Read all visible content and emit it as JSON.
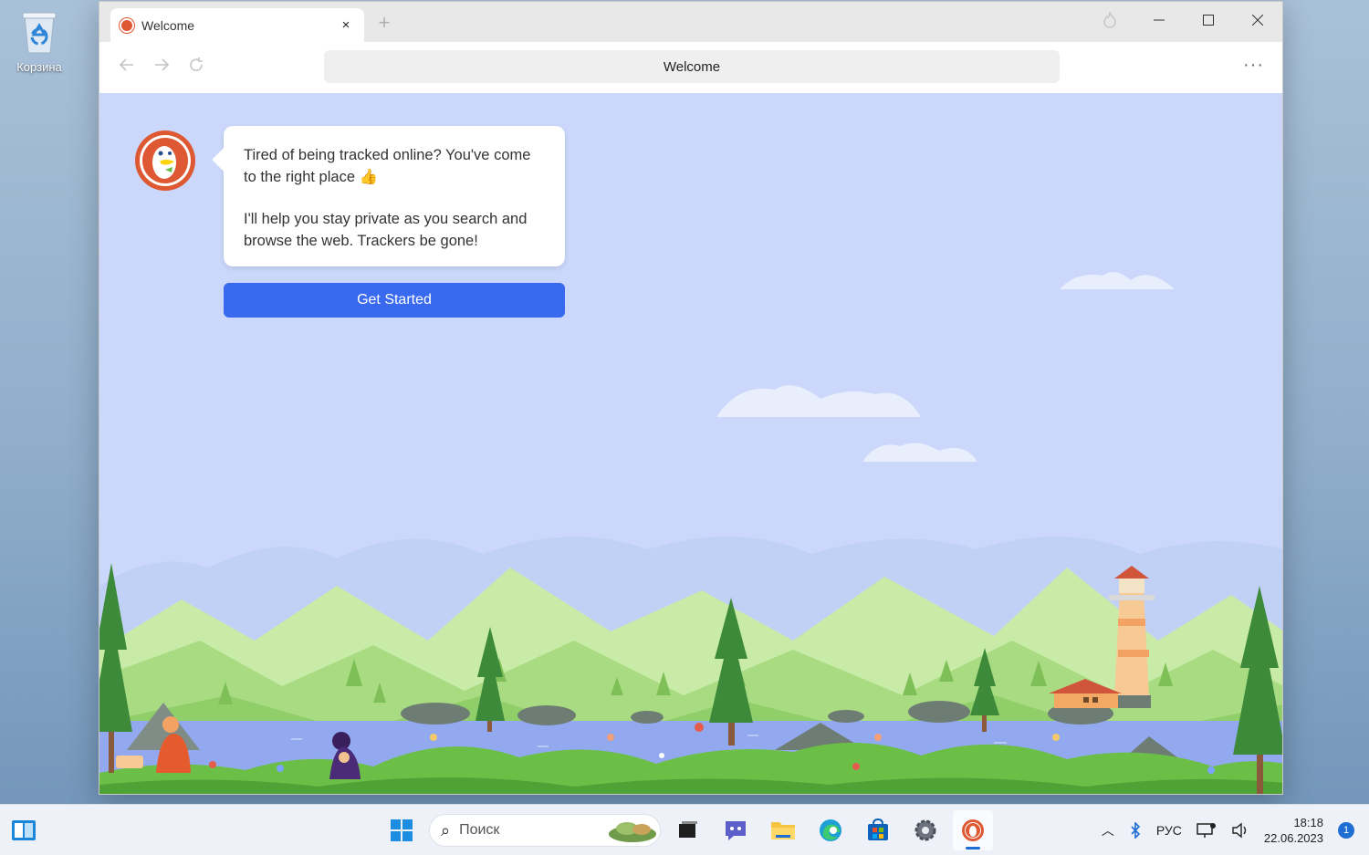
{
  "desktop": {
    "recycle_bin_label": "Корзина"
  },
  "browser": {
    "tab_title": "Welcome",
    "tab_close": "×",
    "new_tab": "+",
    "address_text": "Welcome",
    "menu_dots": "···",
    "window_controls": [
      "minimize",
      "maximize",
      "close"
    ]
  },
  "welcome": {
    "message_line1": "Tired of being tracked online?  You've come to the right place 👍",
    "message_line2": "I'll help you stay private as you search and browse the web. Trackers be gone!",
    "cta_label": "Get Started"
  },
  "taskbar": {
    "search_placeholder": "Поиск",
    "language": "РУС",
    "time": "18:18",
    "date": "22.06.2023",
    "notification_count": "1"
  },
  "colors": {
    "accent": "#3969ef",
    "page_bg": "#cbd8fb",
    "brand": "#de5833"
  }
}
